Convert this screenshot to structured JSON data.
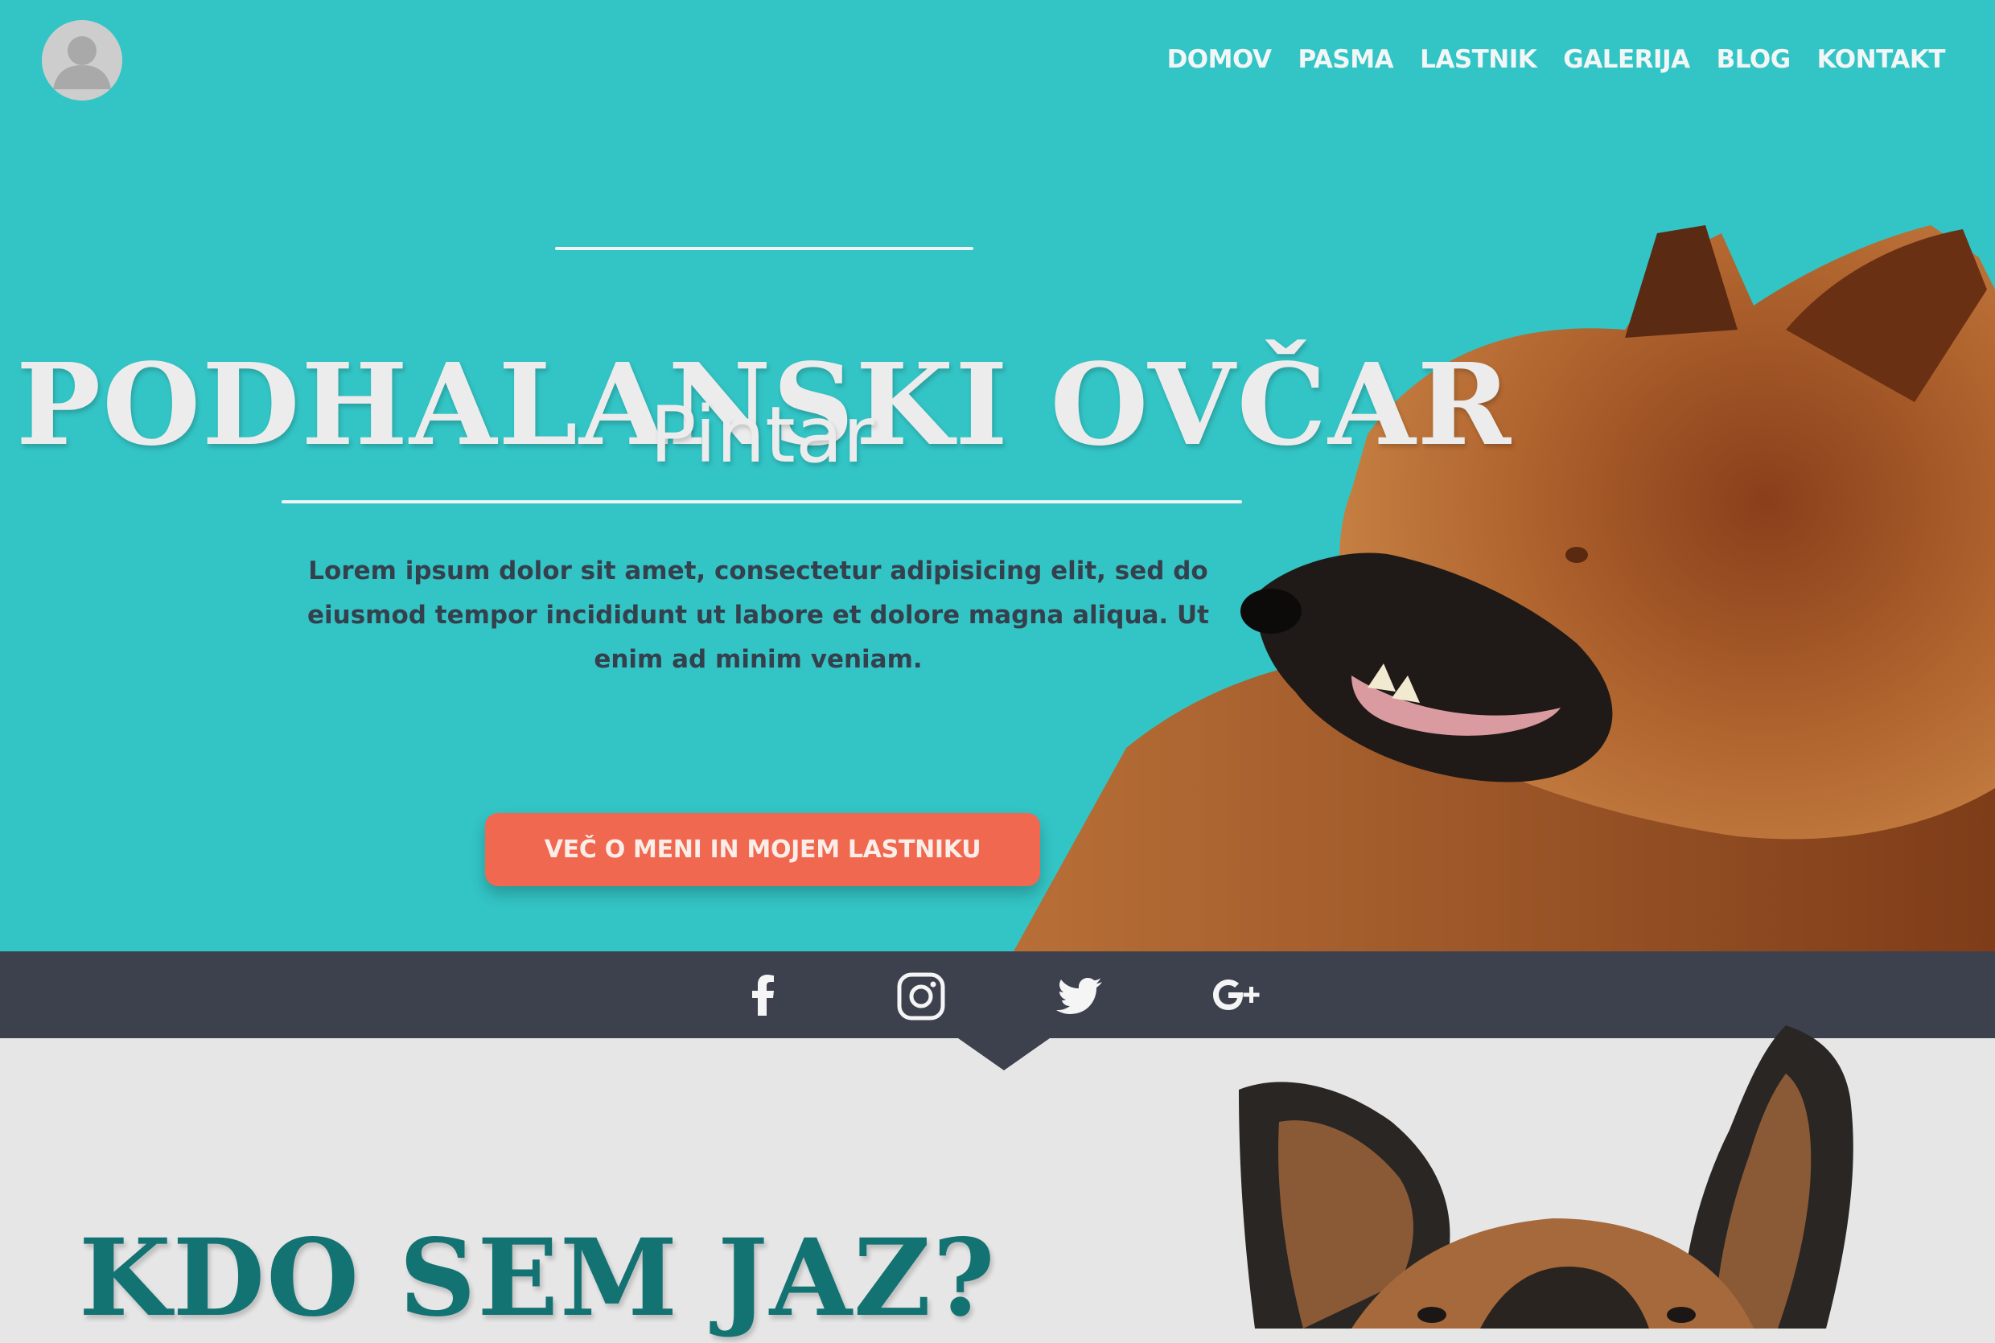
{
  "header": {
    "avatar_icon": "user-avatar-icon",
    "nav": [
      {
        "label": "DOMOV"
      },
      {
        "label": "PASMA"
      },
      {
        "label": "LASTNIK"
      },
      {
        "label": "GALERIJA"
      },
      {
        "label": "BLOG"
      },
      {
        "label": "KONTAKT"
      }
    ]
  },
  "hero": {
    "title": "PODHALANSKI OVČAR",
    "subtitle": "Pintar",
    "lead": "Lorem ipsum dolor sit amet, consectetur adipisicing elit, sed do eiusmod tempor incididunt ut labore et dolore magna aliqua. Ut enim ad minim veniam.",
    "cta_label": "VEČ O MENI IN MOJEM LASTNIKU",
    "image": "german-shepherd-profile-photo"
  },
  "social": {
    "icons": [
      "facebook-icon",
      "instagram-icon",
      "twitter-icon",
      "google-plus-icon"
    ]
  },
  "about": {
    "title": "KDO SEM JAZ?",
    "image": "german-shepherd-ears-photo"
  },
  "colors": {
    "hero_bg": "#33c4c5",
    "social_bar_bg": "#3d414e",
    "cta_bg": "#f0684f",
    "about_bg": "#e6e6e6",
    "about_title": "#137272"
  }
}
